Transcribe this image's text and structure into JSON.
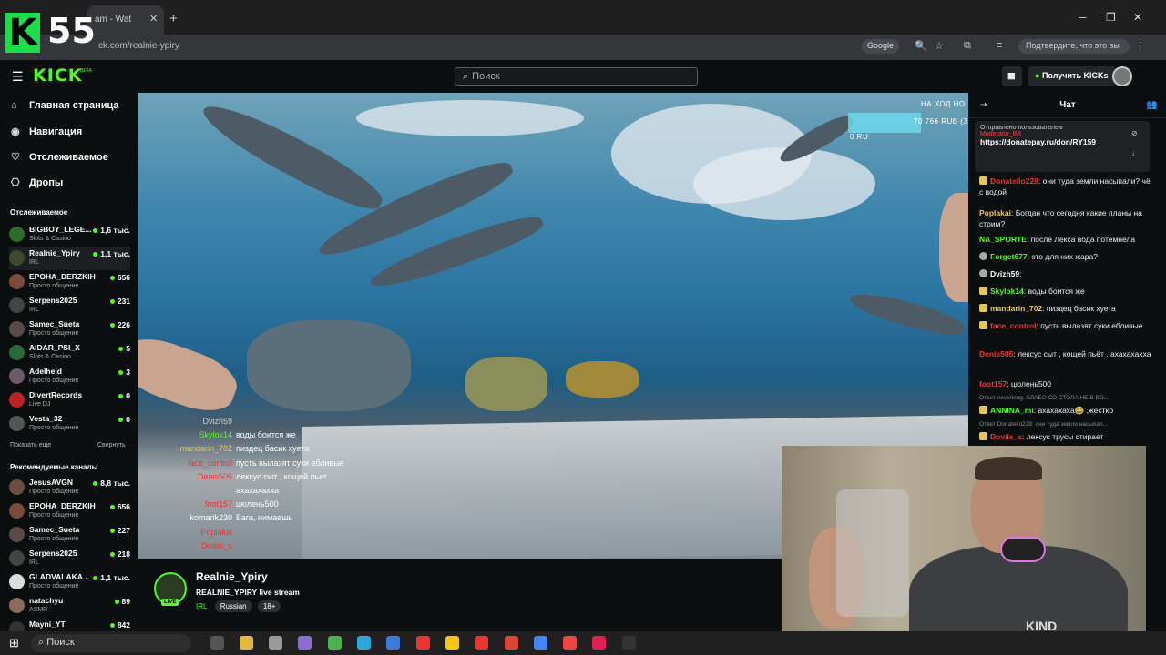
{
  "browser": {
    "tab_title": "am - Wat",
    "close_tab": "✕",
    "new_tab": "+",
    "url_host": "kick.com",
    "url_path": "/realnie-ypiry",
    "url_visible": "ck.com/realnie-ypiry",
    "google_chip": "Google",
    "verify_chip": "Подтвердите, что это вы",
    "win_min": "─",
    "win_max": "❐",
    "win_close": "✕"
  },
  "overlay_logo": {
    "letter": "K",
    "number": "55"
  },
  "kick": {
    "logo": "KICK",
    "beta": "BETA",
    "search_placeholder": "Поиск",
    "get_kicks": "Получить KICKs"
  },
  "sidebar": {
    "nav": [
      {
        "label": "Главная страница",
        "icon": "home-icon"
      },
      {
        "label": "Навигация",
        "icon": "browse-icon"
      },
      {
        "label": "Отслеживаемое",
        "icon": "heart-icon"
      },
      {
        "label": "Дропы",
        "icon": "drops-icon"
      }
    ],
    "followed_title": "Отслеживаемое",
    "followed": [
      {
        "name": "BIGBOY_LEGE...",
        "category": "Slots & Casino",
        "viewers": "1,6 тыс.",
        "color": "#2f6b2a"
      },
      {
        "name": "Realnie_Ypiry",
        "category": "IRL",
        "viewers": "1,1 тыс.",
        "color": "#3a4a2a"
      },
      {
        "name": "EPOHA_DERZKIH",
        "category": "Просто общение",
        "viewers": "656",
        "color": "#7a4a3a"
      },
      {
        "name": "Serpens2025",
        "category": "IRL",
        "viewers": "231",
        "color": "#444"
      },
      {
        "name": "Samec_Sueta",
        "category": "Просто общение",
        "viewers": "226",
        "color": "#5a4a4a"
      },
      {
        "name": "AIDAR_PSI_X",
        "category": "Slots & Casino",
        "viewers": "5",
        "color": "#2a6a3a"
      },
      {
        "name": "Adelheid",
        "category": "Просто общение",
        "viewers": "3",
        "color": "#6a5a6a"
      },
      {
        "name": "DivertRecords",
        "category": "Live DJ",
        "viewers": "0",
        "color": "#b22"
      },
      {
        "name": "Vesta_32",
        "category": "Просто общение",
        "viewers": "0",
        "color": "#555"
      }
    ],
    "show_more": "Показать еще",
    "collapse": "Свернуть",
    "recommended_title": "Рекомендуемые каналы",
    "recommended": [
      {
        "name": "JesusAVGN",
        "category": "Просто общение",
        "viewers": "8,8 тыс.",
        "color": "#6a5040"
      },
      {
        "name": "EPOHA_DERZKIH",
        "category": "Просто общение",
        "viewers": "656",
        "color": "#7a4a3a"
      },
      {
        "name": "Samec_Sueta",
        "category": "Просто общение",
        "viewers": "227",
        "color": "#5a4a4a"
      },
      {
        "name": "Serpens2025",
        "category": "IRL",
        "viewers": "218",
        "color": "#444"
      },
      {
        "name": "GLADVALAKA...",
        "category": "Просто общение",
        "viewers": "1,1 тыс.",
        "color": "#ddd"
      },
      {
        "name": "natachyu",
        "category": "ASMR",
        "viewers": "89",
        "color": "#8a6a5a"
      },
      {
        "name": "Mayni_YT",
        "category": "",
        "viewers": "842",
        "color": "#333"
      }
    ]
  },
  "video_overlay": {
    "goal_label": "НА ХОД НО",
    "goal_amount": "70 766 RUB (3",
    "goal_zero": "0 RU",
    "chat": [
      {
        "user": "Dvizh59",
        "text": "",
        "color": "#ccc"
      },
      {
        "user": "Skylok14",
        "text": "воды боится же",
        "color": "#53fc18"
      },
      {
        "user": "mandarin_702",
        "text": "пиздец басик хуета",
        "color": "#e8c64a"
      },
      {
        "user": "face_control",
        "text": "пусть вылазят суки ебливые",
        "color": "#e33"
      },
      {
        "user": "Denis505",
        "text": "лексус сыт , кощей пьет",
        "color": "#e33"
      },
      {
        "user": "",
        "text": "ахахахахха",
        "color": "#fff"
      },
      {
        "user": "foot157",
        "text": "цюлень500",
        "color": "#e33"
      },
      {
        "user": "komarik230",
        "text": "Бага, нимаешь",
        "color": "#fff"
      },
      {
        "user": "Poplakai",
        "text": "",
        "color": "#e33"
      },
      {
        "user": "Dovils_s",
        "text": "",
        "color": "#e33"
      }
    ]
  },
  "stream": {
    "streamer": "Realnie_Ypiry",
    "live": "LIVE",
    "title": "REALNIE_YPIRY live stream",
    "category": "IRL",
    "tags": [
      "Russian",
      "18+"
    ]
  },
  "chat": {
    "title": "Чат",
    "pinned_label": "Отправлено пользователем",
    "pinned_user": "Moderator_BB",
    "pinned_link": "https://donatepay.ru/don/RY159",
    "messages": [
      {
        "user": "Donatello228",
        "text": "они туда земли насыпали? чё с водой",
        "color": "#e33",
        "badge": "gold"
      },
      {
        "user": "Poplakai",
        "text": "Богдан что сегодня какие планы на стрим?",
        "color": "#e8c64a",
        "badge": ""
      },
      {
        "user": "NA_SPORTE",
        "text": "после Лекса вода потемнела",
        "color": "#53fc18",
        "badge": ""
      },
      {
        "user": "Forget677",
        "text": "это для них жара?",
        "color": "#53fc18",
        "badge": "grey"
      },
      {
        "user": "Dvizh59",
        "text": "",
        "color": "#fff",
        "badge": "grey"
      },
      {
        "user": "Skylok14",
        "text": "воды боится же",
        "color": "#53fc18",
        "badge": "gold"
      },
      {
        "user": "mandarin_702",
        "text": "пиздец басик хуета",
        "color": "#e8c64a",
        "badge": "gold"
      },
      {
        "user": "face_control",
        "text": "пусть вылазят суки ебливые",
        "color": "#e33",
        "badge": "gold"
      },
      {
        "user": "Denis505",
        "text": "лексус сыт , кощей пьёт . ахахахахха",
        "color": "#e33",
        "badge": ""
      },
      {
        "user": "foot157",
        "text": "цюлень500",
        "color": "#e33",
        "badge": ""
      },
      {
        "user": "ANNINA_mi",
        "text": "ахахахаха😂 ,жестко",
        "color": "#53fc18",
        "badge": "gold"
      },
      {
        "user": "Dovils_s",
        "text": "лексус трусы стирает",
        "color": "#e33",
        "badge": "gold"
      }
    ],
    "reply_1": "Ответ neverking: СЛАБО СО СТОЛА НЕ В ВО...",
    "reply_2": "Ответ Donatello228: они туда земли насыпал..."
  },
  "webcam": {
    "shirt_text": "KIND"
  },
  "taskbar": {
    "search": "Поиск"
  }
}
